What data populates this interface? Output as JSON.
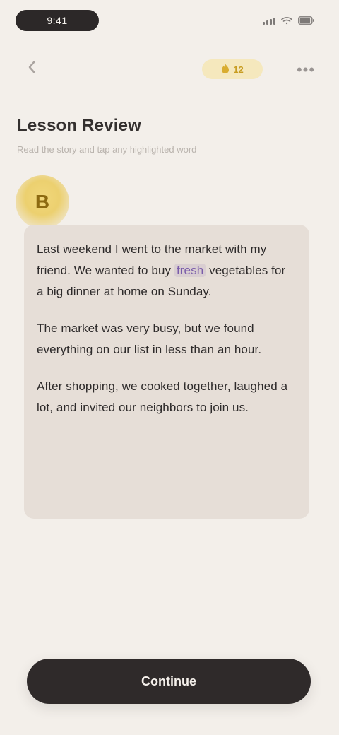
{
  "status_bar": {
    "time": "9:41"
  },
  "nav": {
    "back_label": "‹",
    "streak": "12",
    "more_label": "•••"
  },
  "lesson": {
    "title": "Lesson Review",
    "subtitle": "Read the story and tap any highlighted word",
    "avatar_initial": "B"
  },
  "message": {
    "paragraph_1_start": "Last weekend I went to the market with my friend. We wanted to buy",
    "highlight": "fresh",
    "paragraph_1_end": "vegetables for a big dinner at home on Sunday.",
    "paragraph_2": "The market was very busy, but we found everything on our list in less than an hour.",
    "paragraph_3": "After shopping, we cooked together, laughed a lot, and invited our neighbors to join us."
  },
  "footer": {
    "continue_label": "Continue"
  },
  "colors": {
    "background": "#f3efea",
    "card": "#e6ded7",
    "accent_yellow": "#ecd06f",
    "button_dark": "#2f2a2a",
    "highlight_purple": "#7a5caa"
  },
  "icons": {
    "back": "back-icon",
    "streak": "fire-icon",
    "more": "more-icon",
    "signal": "signal-icon",
    "wifi": "wifi-icon",
    "battery": "battery-icon"
  }
}
